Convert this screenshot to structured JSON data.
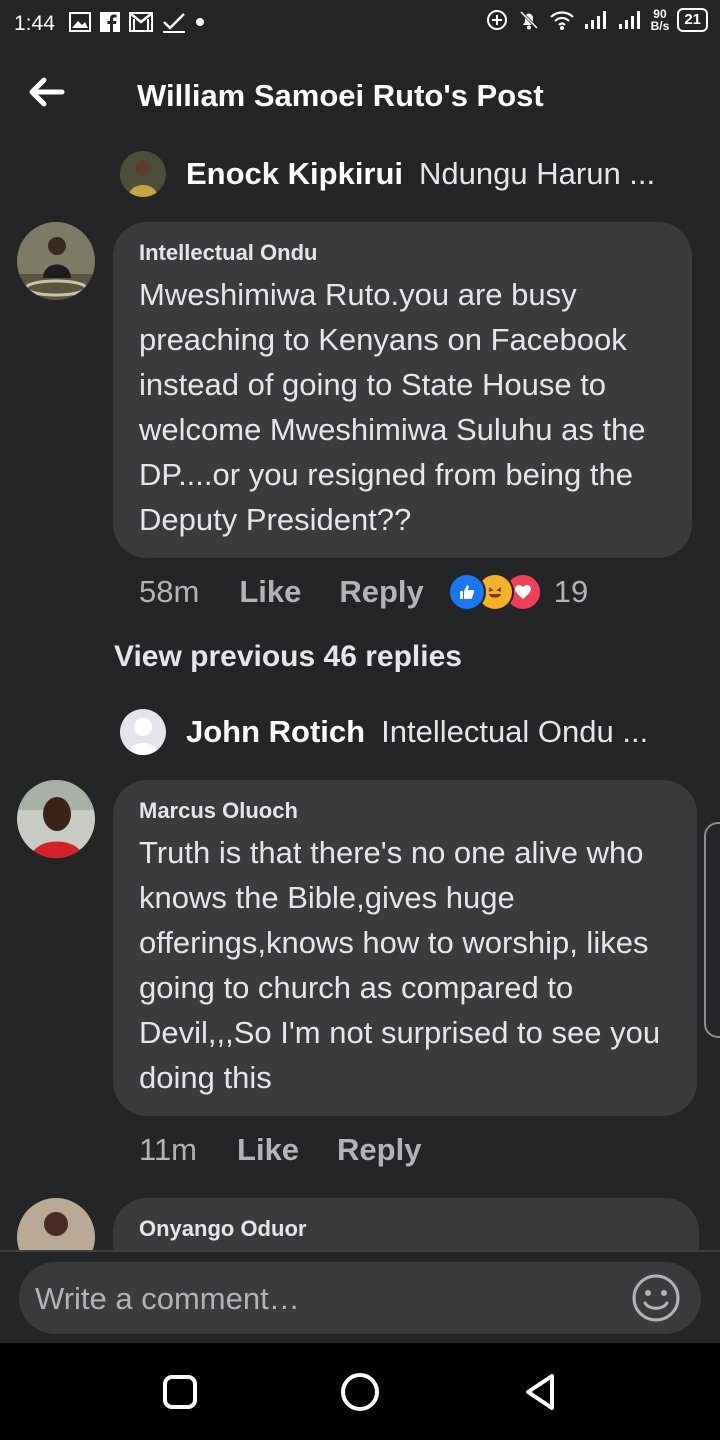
{
  "status_bar": {
    "time": "1:44",
    "net_speed_value": "90",
    "net_speed_unit": "B/s",
    "battery": "21"
  },
  "header": {
    "title": "William Samoei Ruto's Post",
    "back_icon": "arrow-left-icon"
  },
  "reply_previews": [
    {
      "name": "Enock Kipkirui",
      "text": "Ndungu Harun ..."
    },
    {
      "name": "John Rotich",
      "text": "Intellectual Ondu ..."
    }
  ],
  "comments": [
    {
      "author": "Intellectual Ondu",
      "text": "Mweshimiwa Ruto.you are busy preaching to Kenyans on Facebook instead of going to State House to welcome Mweshimiwa Suluhu as the DP....or you resigned from being the Deputy President??",
      "time": "58m",
      "like_label": "Like",
      "reply_label": "Reply",
      "reaction_count": "19",
      "reactions": [
        "like-reaction-icon",
        "haha-reaction-icon",
        "love-reaction-icon"
      ]
    },
    {
      "author": "Marcus Oluoch",
      "text": "Truth is that there's no one alive who knows the Bible,gives huge offerings,knows how to worship, likes going to church as compared to Devil,,,So I'm not surprised to see you doing this",
      "time": "11m",
      "like_label": "Like",
      "reply_label": "Reply"
    },
    {
      "author": "Onyango Oduor"
    }
  ],
  "view_previous": "View previous 46 replies",
  "composer": {
    "placeholder": "Write a comment…"
  },
  "colors": {
    "background": "#242526",
    "bubble": "#3a3b3c",
    "like_blue": "#1877f2",
    "love_red": "#f33e58",
    "haha_yellow": "#f7b125"
  }
}
